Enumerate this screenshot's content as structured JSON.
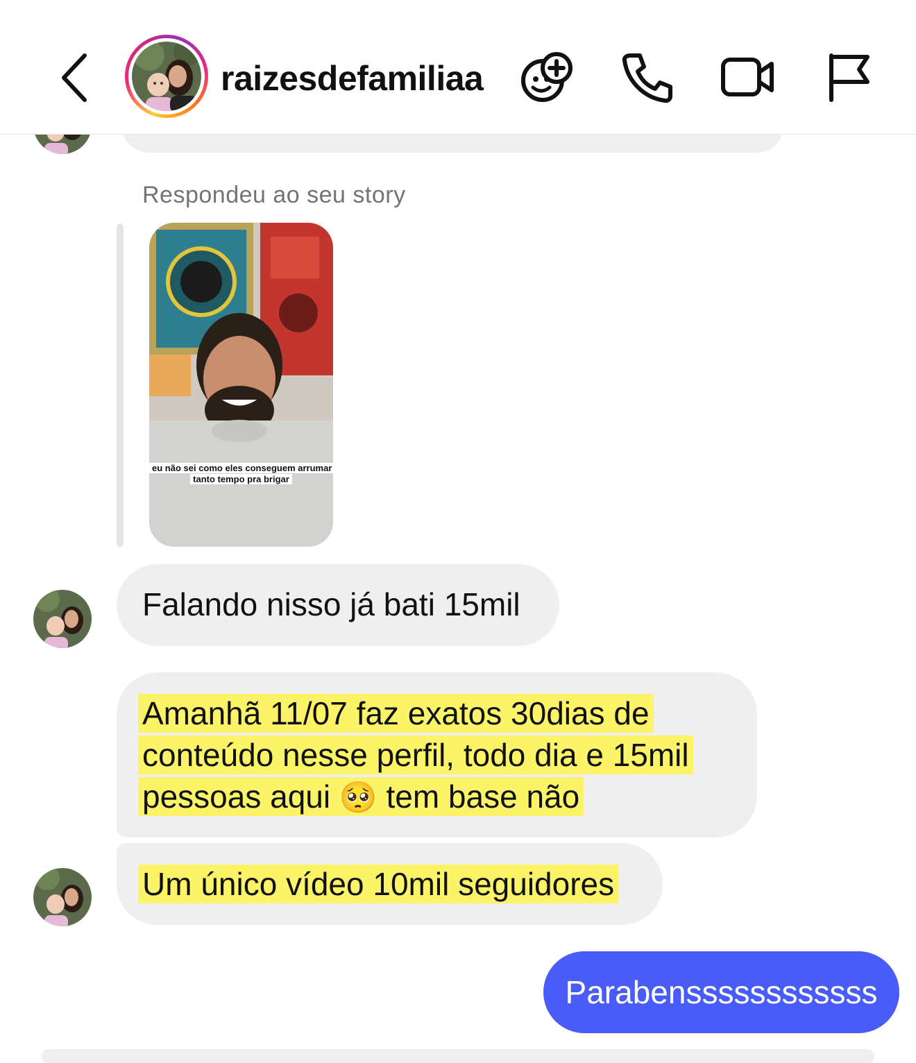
{
  "header": {
    "username": "raizesdefamiliaa",
    "icons": {
      "back": "chevron-left-icon",
      "effects": "sticker-smile-add-icon",
      "call": "phone-icon",
      "video": "video-camera-icon",
      "report": "flag-icon"
    }
  },
  "thread": {
    "reply_label": "Respondeu ao seu story",
    "story_caption": "eu não sei como eles conseguem arrumar tanto tempo pra brigar",
    "messages": [
      {
        "from": "them",
        "text": "Falando nisso já bati 15mil"
      },
      {
        "from": "them",
        "text": "Amanhã 11/07 faz exatos 30dias de conteúdo nesse perfil, todo dia e 15mil pessoas aqui",
        "emoji": "🥺",
        "text_after": "tem base não",
        "highlighted": true
      },
      {
        "from": "them",
        "text": "Um único vídeo 10mil seguidores",
        "highlighted": true
      },
      {
        "from": "me",
        "text": "Parabenssssssssssss"
      }
    ]
  },
  "colors": {
    "sent_bubble": "#4a5cf7",
    "received_bubble": "#efefef",
    "highlight": "#fff53c"
  }
}
